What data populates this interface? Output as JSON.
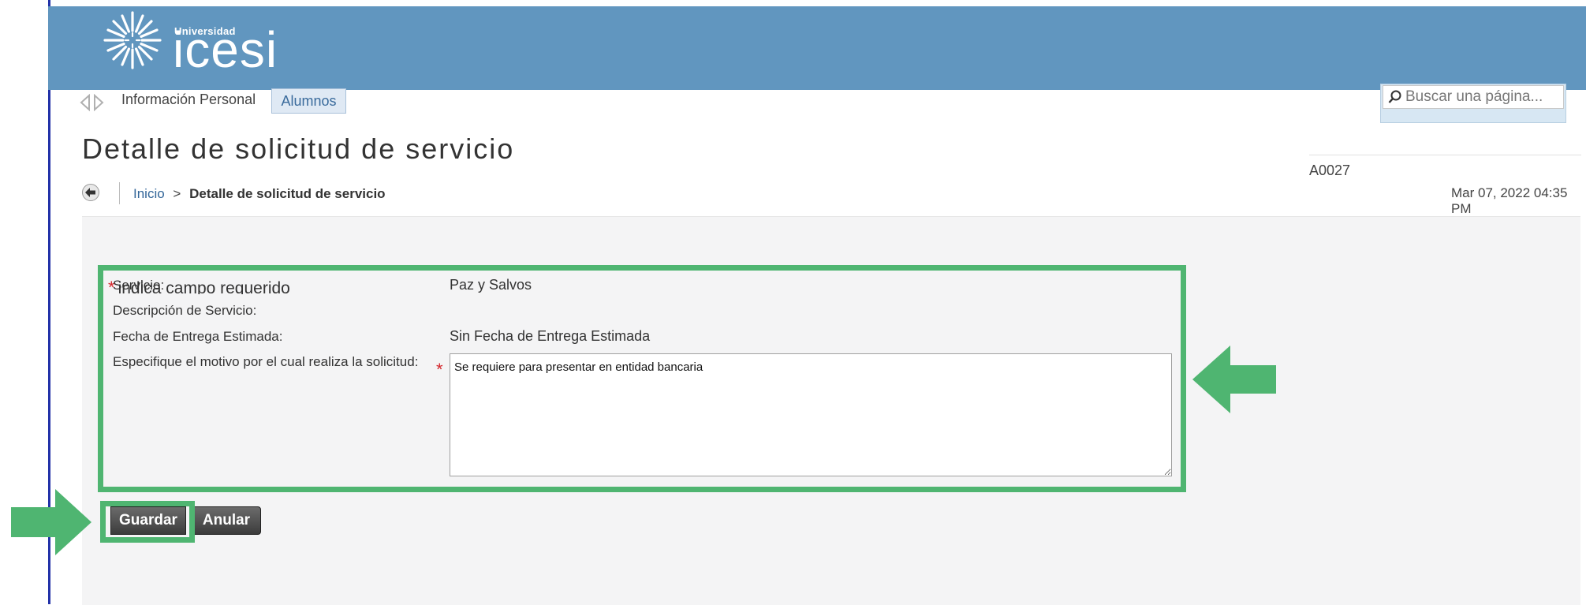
{
  "header": {
    "logo_sub": "Universidad",
    "logo_main": "icesi",
    "brand_color": "#6196bf"
  },
  "search": {
    "placeholder": "Buscar una página..."
  },
  "nav": {
    "items": [
      {
        "label": "Información Personal"
      },
      {
        "label": "Alumnos"
      }
    ]
  },
  "page": {
    "title": "Detalle de solicitud de servicio",
    "code": "A0027",
    "datetime": "Mar 07, 2022 04:35 PM"
  },
  "breadcrumb": {
    "home": "Inicio",
    "separator": ">",
    "current": "Detalle de solicitud de servicio"
  },
  "form": {
    "required_note": "indica campo requerido",
    "required_star": "*",
    "fields": [
      {
        "label": "Servicio:",
        "value": "Paz y Salvos"
      },
      {
        "label": "Descripción de Servicio:",
        "value": ""
      },
      {
        "label": "Fecha de Entrega Estimada:",
        "value": "Sin Fecha de Entrega Estimada"
      },
      {
        "label": "Especifique el motivo por el cual realiza la solicitud:",
        "value": "Se requiere para presentar en entidad bancaria"
      }
    ],
    "buttons": {
      "save": "Guardar",
      "cancel": "Anular"
    }
  },
  "annotation_color": "#4fb571"
}
